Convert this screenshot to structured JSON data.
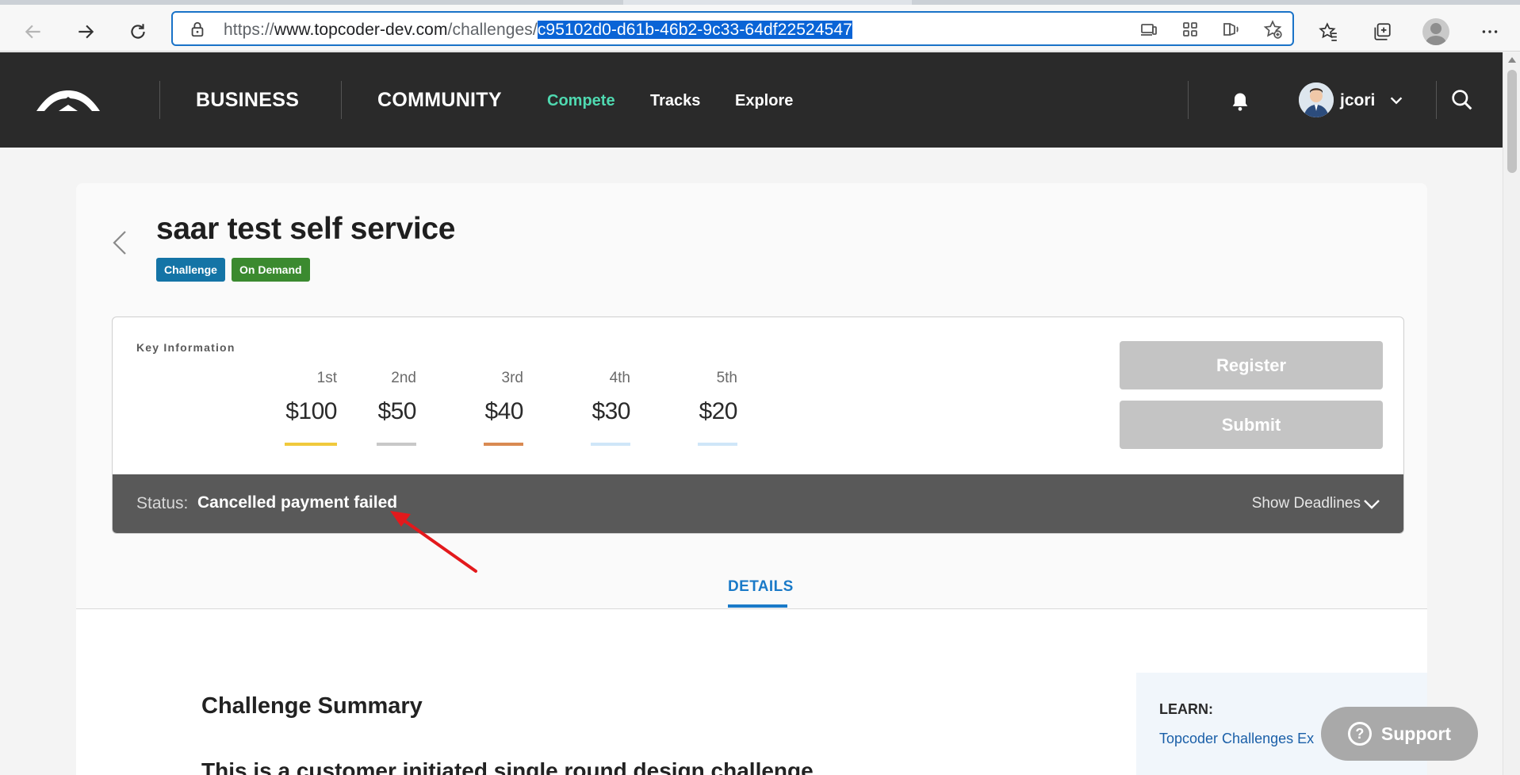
{
  "browser": {
    "url_scheme": "https://",
    "url_host": "www.topcoder-dev.com",
    "url_path": "/challenges/",
    "url_selected": "c95102d0-d61b-46b2-9c33-64df22524547"
  },
  "header": {
    "nav_business": "BUSINESS",
    "nav_community": "COMMUNITY",
    "nav_compete": "Compete",
    "nav_tracks": "Tracks",
    "nav_explore": "Explore",
    "username": "jcori"
  },
  "challenge": {
    "title": "saar test self service",
    "badges": [
      "Challenge",
      "On Demand"
    ]
  },
  "key_info": {
    "label": "Key Information",
    "prizes": [
      {
        "place": "1st",
        "amount": "$100",
        "color": "#f0c93c"
      },
      {
        "place": "2nd",
        "amount": "$50",
        "color": "#c8c8c8"
      },
      {
        "place": "3rd",
        "amount": "$40",
        "color": "#d98a52"
      },
      {
        "place": "4th",
        "amount": "$30",
        "color": "#cfe6f8"
      },
      {
        "place": "5th",
        "amount": "$20",
        "color": "#cfe6f8"
      }
    ],
    "register_label": "Register",
    "submit_label": "Submit",
    "status_label": "Status:",
    "status_value": "Cancelled payment failed",
    "show_deadlines": "Show Deadlines"
  },
  "tabs": {
    "details": "DETAILS"
  },
  "content": {
    "summary_title": "Challenge Summary",
    "summary_text": "This is a customer initiated single round design challenge",
    "learn_title": "LEARN:",
    "learn_link": "Topcoder Challenges Ex"
  },
  "support_label": "Support",
  "colors": {
    "badge_challenge": "#1474a6",
    "badge_on_demand": "#3b8a2f",
    "accent_blue": "#1a7ac8",
    "compete_green": "#4fd9b0",
    "annotation_red": "#e3191c"
  }
}
